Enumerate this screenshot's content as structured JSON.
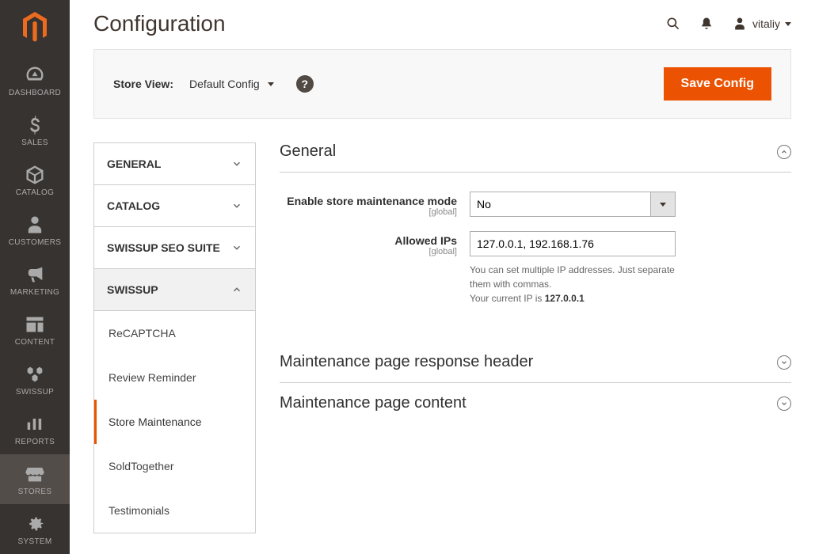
{
  "page_title": "Configuration",
  "user_name": "vitaliy",
  "sidebar_nav": [
    {
      "id": "dashboard",
      "label": "DASHBOARD"
    },
    {
      "id": "sales",
      "label": "SALES"
    },
    {
      "id": "catalog",
      "label": "CATALOG"
    },
    {
      "id": "customers",
      "label": "CUSTOMERS"
    },
    {
      "id": "marketing",
      "label": "MARKETING"
    },
    {
      "id": "content",
      "label": "CONTENT"
    },
    {
      "id": "swissup",
      "label": "SWISSUP"
    },
    {
      "id": "reports",
      "label": "REPORTS"
    },
    {
      "id": "stores",
      "label": "STORES"
    },
    {
      "id": "system",
      "label": "SYSTEM"
    }
  ],
  "toolbar": {
    "scope_label": "Store View:",
    "scope_value": "Default Config",
    "save_label": "Save Config"
  },
  "config_tabs": {
    "sections": [
      {
        "label": "GENERAL",
        "expanded": false
      },
      {
        "label": "CATALOG",
        "expanded": false
      },
      {
        "label": "SWISSUP SEO SUITE",
        "expanded": false
      },
      {
        "label": "SWISSUP",
        "expanded": true
      }
    ],
    "sub_items": [
      {
        "label": "ReCAPTCHA",
        "active": false
      },
      {
        "label": "Review Reminder",
        "active": false
      },
      {
        "label": "Store Maintenance",
        "active": true
      },
      {
        "label": "SoldTogether",
        "active": false
      },
      {
        "label": "Testimonials",
        "active": false
      }
    ]
  },
  "form": {
    "general": {
      "title": "General",
      "enable_label": "Enable store maintenance mode",
      "enable_scope": "[global]",
      "enable_value": "No",
      "allowed_ips_label": "Allowed IPs",
      "allowed_ips_scope": "[global]",
      "allowed_ips_value": "127.0.0.1, 192.168.1.76",
      "allowed_ips_note1": "You can set multiple IP addresses. Just separate them with commas.",
      "allowed_ips_note2_prefix": "Your current IP is ",
      "allowed_ips_note2_ip": "127.0.0.1"
    },
    "section2_title": "Maintenance page response header",
    "section3_title": "Maintenance page content"
  }
}
